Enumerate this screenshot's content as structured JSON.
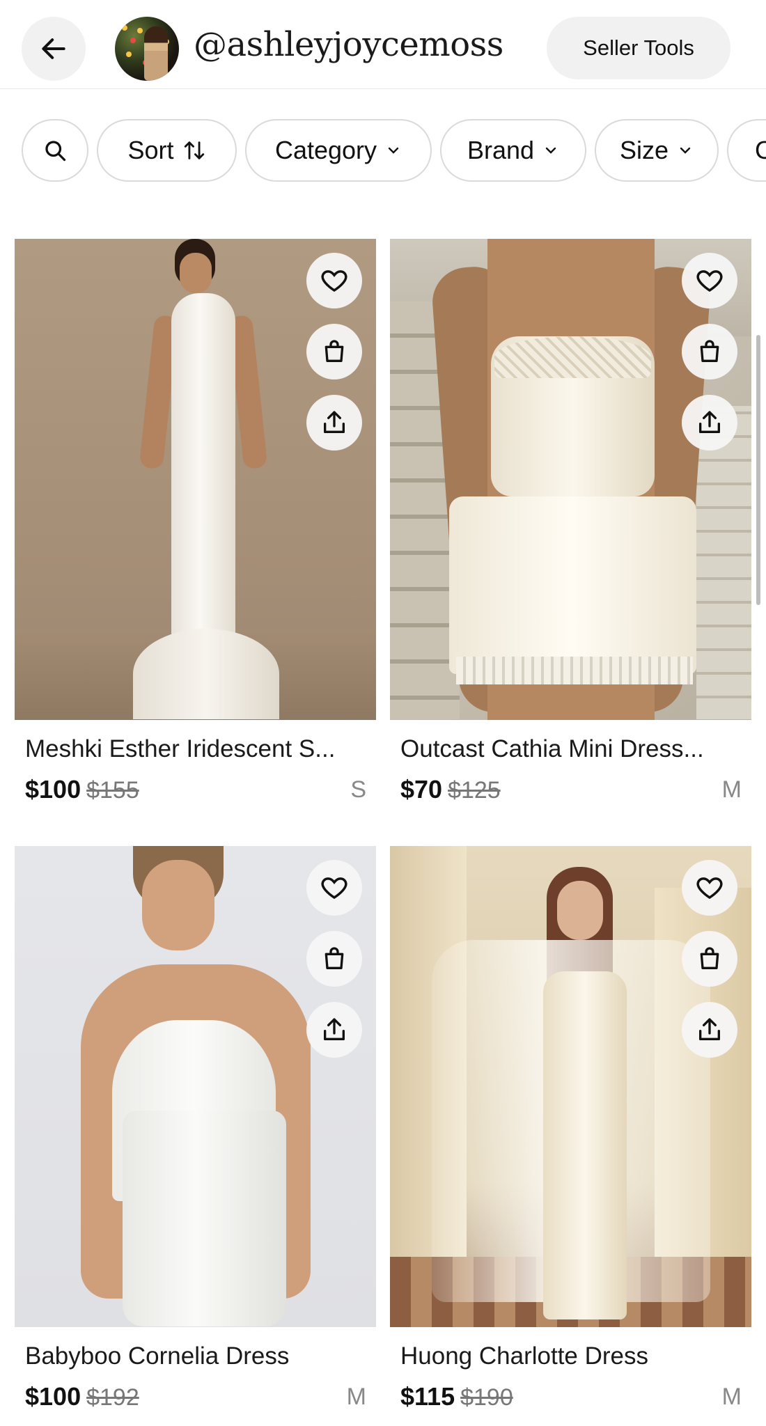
{
  "header": {
    "username": "@ashleyjoycemoss",
    "seller_tools_label": "Seller Tools"
  },
  "filters": {
    "sort_label": "Sort",
    "category_label": "Category",
    "brand_label": "Brand",
    "size_label": "Size",
    "next_label": "C"
  },
  "icons": [
    "back-arrow-icon",
    "search-icon",
    "sort-arrows-icon",
    "chevron-down-icon",
    "heart-icon",
    "shopping-bag-icon",
    "share-icon"
  ],
  "colors": {
    "background": "#ffffff",
    "chip_border": "#dadada",
    "button_fill": "#f1f1f1",
    "strike_price": "#777777"
  },
  "listings": [
    {
      "title": "Meshki Esther Iridescent S...",
      "price": "$100",
      "original_price": "$155",
      "size": "S"
    },
    {
      "title": "Outcast Cathia Mini Dress...",
      "price": "$70",
      "original_price": "$125",
      "size": "M"
    },
    {
      "title": "Babyboo Cornelia Dress",
      "price": "$100",
      "original_price": "$192",
      "size": "M"
    },
    {
      "title": "Huong Charlotte Dress",
      "price": "$115",
      "original_price": "$190",
      "size": "M"
    }
  ]
}
